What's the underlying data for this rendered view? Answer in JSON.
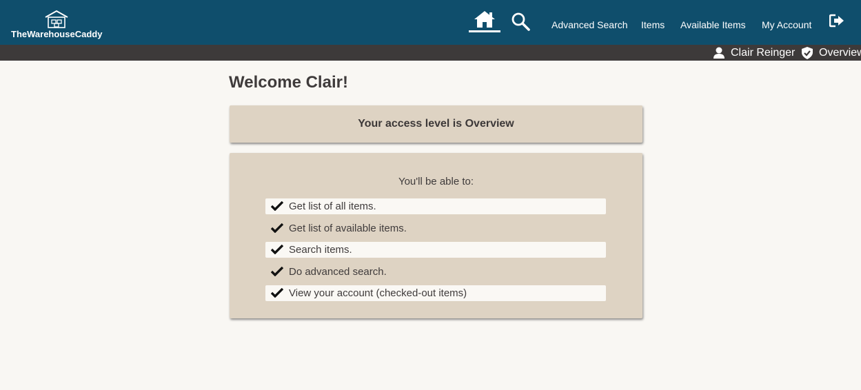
{
  "brand": {
    "name": "TheWarehouseCaddy",
    "icon": "warehouse-icon"
  },
  "nav": {
    "home_icon": "home-icon",
    "search_icon": "search-icon",
    "links": [
      "Advanced Search",
      "Items",
      "Available Items",
      "My Account"
    ],
    "logout_icon": "logout-icon"
  },
  "userbar": {
    "user_icon": "user-icon",
    "user_name": "Clair Reinger",
    "level_icon": "shield-check-icon",
    "access_level": "Overview"
  },
  "main": {
    "welcome": "Welcome Clair!",
    "access_message": "Your access level is Overview",
    "permissions_intro": "You'll be able to:",
    "permissions": [
      "Get list of all items.",
      "Get list of available items.",
      "Search items.",
      "Do advanced search.",
      "View your account (checked-out items)"
    ]
  },
  "colors": {
    "navbar": "#0f4e6c",
    "userbar": "#3d3a3a",
    "card": "#ded3c3",
    "background": "#f9f7f3"
  }
}
